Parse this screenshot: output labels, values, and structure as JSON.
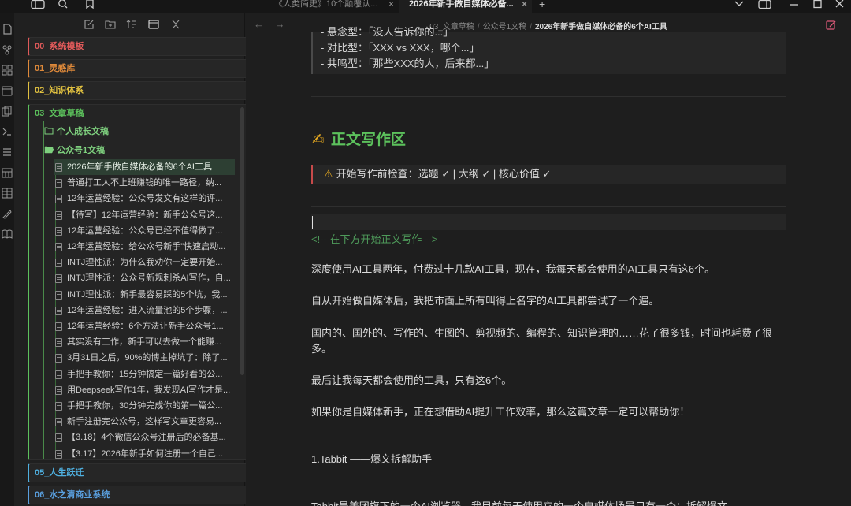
{
  "tabs": [
    {
      "label": "《人类简史》10个颠覆认...",
      "active": false
    },
    {
      "label": "2026年新手做自媒体必备...",
      "active": true
    }
  ],
  "new_tab_symbol": "+",
  "close_symbol": "×",
  "sidebar": {
    "folders": [
      {
        "label": "00_系统模板",
        "color": "#e05a5a"
      },
      {
        "label": "01_灵感库",
        "color": "#e08a3a"
      },
      {
        "label": "02_知识体系",
        "color": "#e0c040"
      },
      {
        "label": "03_文章草稿",
        "color": "#5cc15c"
      },
      {
        "label": "05_人生跃迁",
        "color": "#4fb0e0"
      },
      {
        "label": "06_水之清商业系统",
        "color": "#5aa0e0"
      }
    ],
    "subfolders": [
      "个人成长文稿",
      "公众号1文稿"
    ],
    "notes": [
      "2026年新手做自媒体必备的6个AI工具",
      "普通打工人不上班赚钱的唯一路径，纳...",
      "12年运营经验：公众号发文有这样的评...",
      "【待写】12年运营经验：新手公众号这...",
      "12年运营经验：公众号已经不值得做了...",
      "12年运营经验：给公众号新手\"快速启动...",
      "INTJ理性派：为什么我劝你一定要开始...",
      "INTJ理性派：公众号新规刺杀AI写作，自...",
      "INTJ理性派：新手最容易踩的5个坑，我...",
      "12年运营经验：进入流量池的5个步骤，...",
      "12年运营经验：6个方法让新手公众号1...",
      "其实没有工作，新手可以去做一个能赚...",
      "3月31日之后，90%的博主掉坑了：除了...",
      "手把手教你：15分钟搞定一篇好看的公...",
      "用Deepseek写作1年，我发现AI写作才是...",
      "手把手教你，30分钟完成你的第一篇公...",
      "新手注册完公众号，这样写文章更容易...",
      "【3.18】4个微信公众号注册后的必备基...",
      "【3.17】2026年新手如何注册一个自己..."
    ]
  },
  "breadcrumb": {
    "parts": [
      "03_文章草稿",
      "公众号1文稿"
    ],
    "current": "2026年新手做自媒体必备的6个AI工具",
    "sep": "/"
  },
  "nav": {
    "back": "←",
    "forward": "→"
  },
  "editor": {
    "quote_lines": [
      "- 悬念型：「没人告诉你的...」",
      "- 对比型：「XXX vs XXX，哪个...」",
      "- 共鸣型：「那些XXX的人，后来都...」"
    ],
    "heading_icon": "✍",
    "heading": "正文写作区",
    "callout_icon": "⚠",
    "callout": "开始写作前检查：选题 ✓ | 大纲 ✓ | 核心价值 ✓",
    "comment": "<!-- 在下方开始正文写作 -->",
    "paragraphs": [
      "深度使用AI工具两年，付费过十几款AI工具，现在，我每天都会使用的AI工具只有这6个。",
      "自从开始做自媒体后，我把市面上所有叫得上名字的AI工具都尝试了一个遍。",
      "国内的、国外的、写作的、生图的、剪视频的、编程的、知识管理的……花了很多钱，时间也耗费了很多。",
      "最后让我每天都会使用的工具，只有这6个。",
      "如果你是自媒体新手，正在想借助AI提升工作效率，那么这篇文章一定可以帮助你！",
      "1.Tabbit ——爆文拆解助手",
      "Tabbit是美团旗下的一个AI浏览器，我目前每天使用它的一个自媒体场景只有一个：拆解爆文。"
    ]
  },
  "colors": {
    "accent_green": "#5cc15c",
    "active_note_bg": "#2d3f33",
    "callout_border": "#c74a4a"
  }
}
